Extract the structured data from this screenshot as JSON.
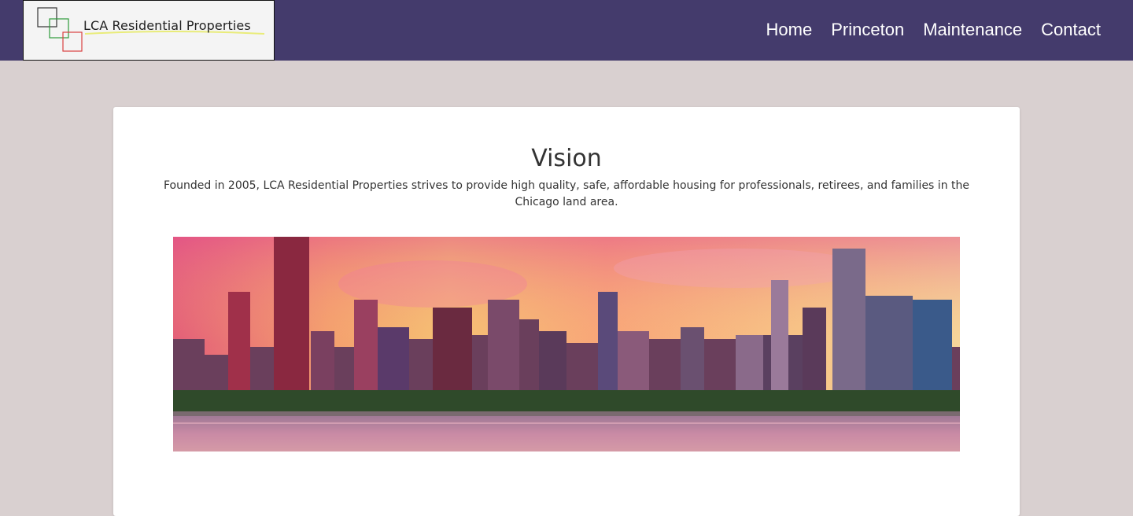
{
  "brand": {
    "name": "LCA Residential Properties"
  },
  "nav": {
    "items": [
      "Home",
      "Princeton",
      "Maintenance",
      "Contact"
    ]
  },
  "main": {
    "title": "Vision",
    "description": "Founded in 2005, LCA Residential Properties strives to provide high quality, safe, affordable housing for professionals, retirees, and families in the Chicago land area.",
    "image": "chicago-skyline-sunset"
  },
  "colors": {
    "header_bg": "#443b6c",
    "page_bg": "#d9d0d0",
    "card_bg": "#ffffff",
    "nav_text": "#ffffff"
  }
}
